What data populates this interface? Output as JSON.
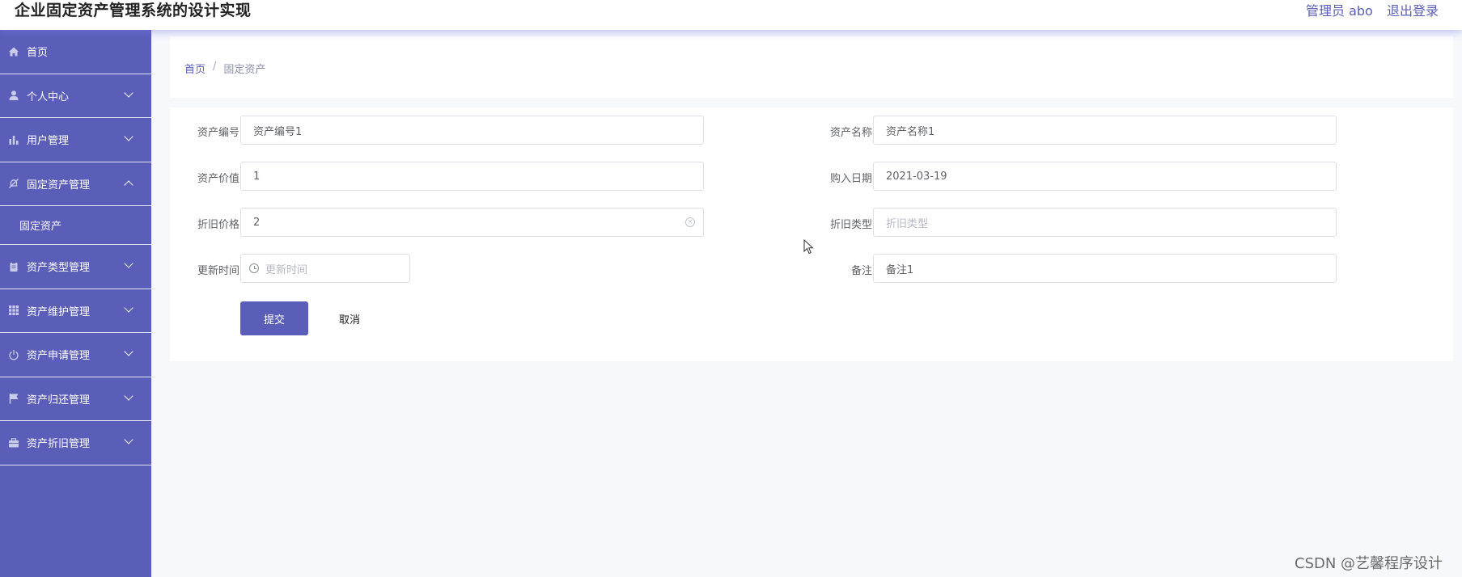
{
  "header": {
    "title": "企业固定资产管理系统的设计实现",
    "user_label": "管理员 abo",
    "logout_label": "退出登录"
  },
  "sidebar": {
    "items": [
      {
        "label": "首页",
        "icon": "home-icon"
      },
      {
        "label": "个人中心",
        "icon": "user-icon"
      },
      {
        "label": "用户管理",
        "icon": "bar-chart-icon"
      },
      {
        "label": "固定资产管理",
        "icon": "bell-off-icon",
        "expanded": true
      },
      {
        "label": "资产类型管理",
        "icon": "clipboard-icon"
      },
      {
        "label": "资产维护管理",
        "icon": "grid-icon"
      },
      {
        "label": "资产申请管理",
        "icon": "power-icon"
      },
      {
        "label": "资产归还管理",
        "icon": "flag-icon"
      },
      {
        "label": "资产折旧管理",
        "icon": "briefcase-icon"
      }
    ],
    "subitems": [
      {
        "label": "固定资产"
      }
    ]
  },
  "breadcrumb": {
    "home": "首页",
    "separator": "/",
    "current": "固定资产"
  },
  "form": {
    "asset_code": {
      "label": "资产编号",
      "value": "资产编号1"
    },
    "asset_name": {
      "label": "资产名称",
      "value": "资产名称1"
    },
    "asset_value": {
      "label": "资产价值",
      "value": "1"
    },
    "purchase_date": {
      "label": "购入日期",
      "value": "2021-03-19"
    },
    "depreciation_price": {
      "label": "折旧价格",
      "value": "2"
    },
    "depreciation_type": {
      "label": "折旧类型",
      "placeholder": "折旧类型"
    },
    "update_time": {
      "label": "更新时间",
      "placeholder": "更新时间"
    },
    "remark": {
      "label": "备注",
      "value": "备注1"
    },
    "submit_label": "提交",
    "cancel_label": "取消"
  },
  "watermark": "CSDN @艺馨程序设计",
  "colors": {
    "primary": "#5b5eb8",
    "background": "#f7f8fc"
  }
}
